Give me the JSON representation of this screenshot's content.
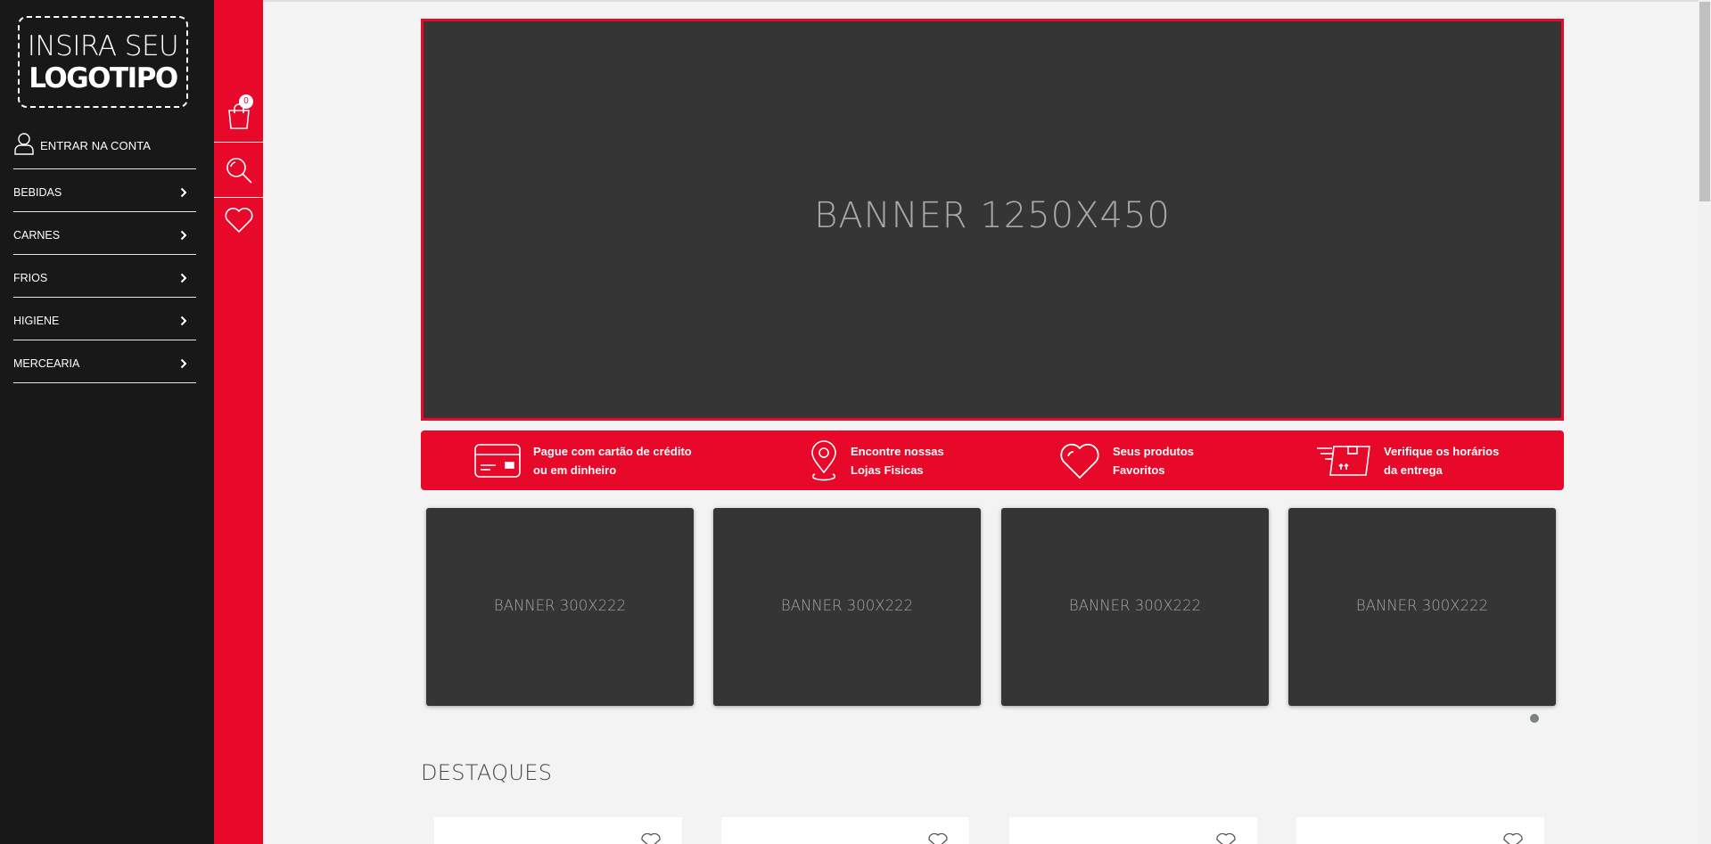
{
  "logo": {
    "line1": "INSIRA SEU",
    "line2": "LOGOTIPO"
  },
  "account": {
    "label": "ENTRAR NA CONTA"
  },
  "menu": [
    {
      "label": "BEBIDAS"
    },
    {
      "label": "CARNES"
    },
    {
      "label": "FRIOS"
    },
    {
      "label": "HIGIENE"
    },
    {
      "label": "MERCEARIA"
    }
  ],
  "cart": {
    "count": "0"
  },
  "hero": {
    "label": "BANNER 1250X450"
  },
  "info": [
    {
      "line1": "Pague com cartão de crédito",
      "line2": "ou em dinheiro",
      "icon": "credit-card-icon"
    },
    {
      "line1": "Encontre nossas",
      "line2": "Lojas Fisicas",
      "icon": "map-pin-icon"
    },
    {
      "line1": "Seus produtos",
      "line2": "Favoritos",
      "icon": "heart-icon"
    },
    {
      "line1": "Verifique os horários",
      "line2": "da entrega",
      "icon": "delivery-box-icon"
    }
  ],
  "small_banners": [
    {
      "label": "BANNER 300X222"
    },
    {
      "label": "BANNER 300X222"
    },
    {
      "label": "BANNER 300X222"
    },
    {
      "label": "BANNER 300X222"
    }
  ],
  "section": {
    "title": "DESTAQUES"
  },
  "colors": {
    "accent": "#e8092a",
    "sidebar": "#181818",
    "banner": "#353535",
    "page": "#f3f3f3"
  }
}
